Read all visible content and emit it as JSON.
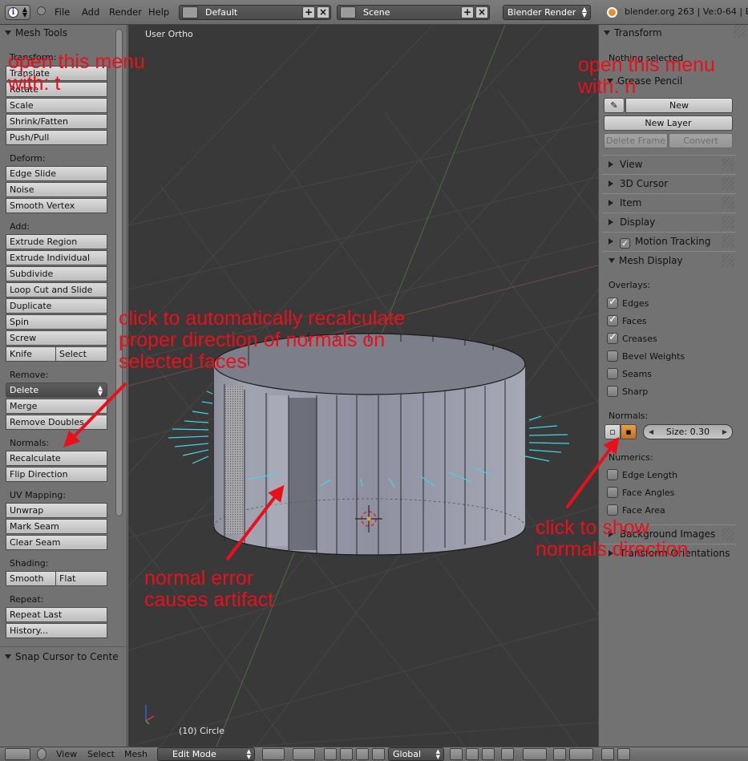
{
  "header": {
    "menus": [
      "File",
      "Add",
      "Render",
      "Help"
    ],
    "screen_layout": "Default",
    "scene": "Scene",
    "render_engine": "Blender Render",
    "version_info": "blender.org 263 | Ve:0-64 | Ed:"
  },
  "tool_shelf": {
    "title": "Mesh Tools",
    "transform_label": "Transform:",
    "transform": [
      "Translate",
      "Rotate",
      "Scale",
      "Shrink/Fatten",
      "Push/Pull"
    ],
    "deform_label": "Deform:",
    "deform": [
      "Edge Slide",
      "Noise",
      "Smooth Vertex"
    ],
    "add_label": "Add:",
    "add": [
      "Extrude Region",
      "Extrude Individual",
      "Subdivide",
      "Loop Cut and Slide",
      "Duplicate",
      "Spin",
      "Screw"
    ],
    "knife": "Knife",
    "select": "Select",
    "remove_label": "Remove:",
    "delete": "Delete",
    "merge": "Merge",
    "remove_doubles": "Remove Doubles",
    "normals_label": "Normals:",
    "recalculate": "Recalculate",
    "flip_direction": "Flip Direction",
    "uv_label": "UV Mapping:",
    "uv": [
      "Unwrap",
      "Mark Seam",
      "Clear Seam"
    ],
    "shading_label": "Shading:",
    "smooth": "Smooth",
    "flat": "Flat",
    "repeat_label": "Repeat:",
    "repeat_last": "Repeat Last",
    "history": "History...",
    "snap_panel": "Snap Cursor to Cente"
  },
  "viewport": {
    "view_name": "User Ortho",
    "object_label": "(10) Circle"
  },
  "properties": {
    "transform_title": "Transform",
    "nothing_selected": "Nothing selected",
    "grease_pencil": "Grease Pencil",
    "new": "New",
    "new_layer": "New Layer",
    "delete_frame": "Delete Frame",
    "convert": "Convert",
    "panels": [
      "View",
      "3D Cursor",
      "Item",
      "Display",
      "Motion Tracking",
      "Mesh Display"
    ],
    "overlays_label": "Overlays:",
    "overlays": [
      {
        "label": "Edges",
        "checked": true
      },
      {
        "label": "Faces",
        "checked": true
      },
      {
        "label": "Creases",
        "checked": true
      },
      {
        "label": "Bevel Weights",
        "checked": false
      },
      {
        "label": "Seams",
        "checked": false
      },
      {
        "label": "Sharp",
        "checked": false
      }
    ],
    "normals_label": "Normals:",
    "normal_size": "Size: 0.30",
    "numerics_label": "Numerics:",
    "numerics": [
      {
        "label": "Edge Length",
        "checked": false
      },
      {
        "label": "Face Angles",
        "checked": false
      },
      {
        "label": "Face Area",
        "checked": false
      }
    ],
    "background_images": "Background Images",
    "transform_orientations": "Transform Orientations"
  },
  "footer": {
    "menus": [
      "View",
      "Select",
      "Mesh"
    ],
    "mode": "Edit Mode",
    "orientation": "Global"
  },
  "annotations": {
    "left_menu": "open this menu\nwith: t",
    "right_menu": "open this menu\nwith: n",
    "recalculate_note": "click to automatically recalculate\nproper direction of normals on\nselected faces",
    "artifact_note": "normal error\ncauses artifact",
    "show_normals_note": "click to show\nnormals direction"
  },
  "colors": {
    "annotation": "#e8101a",
    "normals": "#3fd6e6",
    "viewport_bg": "#393939",
    "panel_bg": "#727272"
  }
}
